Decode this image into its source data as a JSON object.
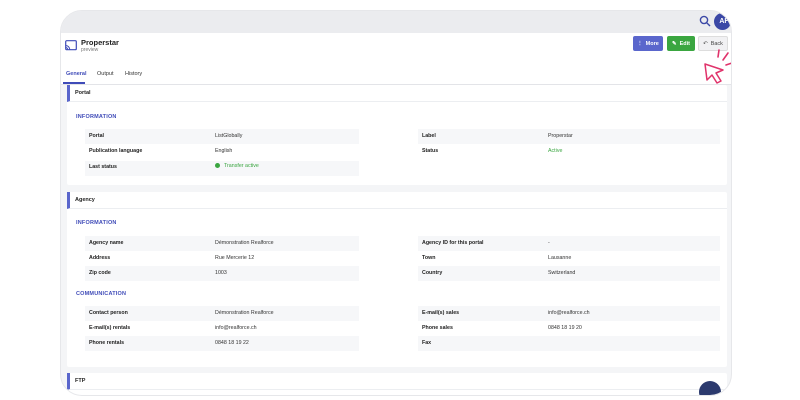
{
  "header": {
    "title": "Properstar",
    "subtitle": "preview",
    "avatar_initials": "AF",
    "buttons": {
      "more": "More",
      "edit": "Edit",
      "back": "Back"
    }
  },
  "tabs": [
    "General",
    "Output",
    "History"
  ],
  "portal": {
    "title": "Portal",
    "section": "INFORMATION",
    "left": [
      {
        "label": "Portal",
        "value": "ListGlobally"
      },
      {
        "label": "Publication language",
        "value": "English"
      },
      {
        "label": "Last status",
        "value": "Transfer active"
      }
    ],
    "right": [
      {
        "label": "Label",
        "value": "Properstar"
      },
      {
        "label": "Status",
        "value": "Active"
      }
    ]
  },
  "agency": {
    "title": "Agency",
    "info_section": "INFORMATION",
    "info_left": [
      {
        "label": "Agency name",
        "value": "Démonstration Realforce"
      },
      {
        "label": "Address",
        "value": "Rue Mercerie 12"
      },
      {
        "label": "Zip code",
        "value": "1003"
      }
    ],
    "info_right": [
      {
        "label": "Agency ID for this portal",
        "value": "-"
      },
      {
        "label": "Town",
        "value": "Lausanne"
      },
      {
        "label": "Country",
        "value": "Switzerland"
      }
    ],
    "comm_section": "COMMUNICATION",
    "comm_left": [
      {
        "label": "Contact person",
        "value": "Démonstration Realforce"
      },
      {
        "label": "E-mail(s) rentals",
        "value": "info@realforce.ch"
      },
      {
        "label": "Phone rentals",
        "value": "0848 18 19 22"
      }
    ],
    "comm_right": [
      {
        "label": "E-mail(s) sales",
        "value": "info@realforce.ch"
      },
      {
        "label": "Phone sales",
        "value": "0848 18 19 20"
      },
      {
        "label": "Fax",
        "value": ""
      }
    ]
  },
  "ftp": {
    "title": "FTP"
  },
  "colors": {
    "accent": "#3f4bb8",
    "more": "#5a66cc",
    "edit": "#3aa640",
    "status_green": "#3aa640"
  }
}
